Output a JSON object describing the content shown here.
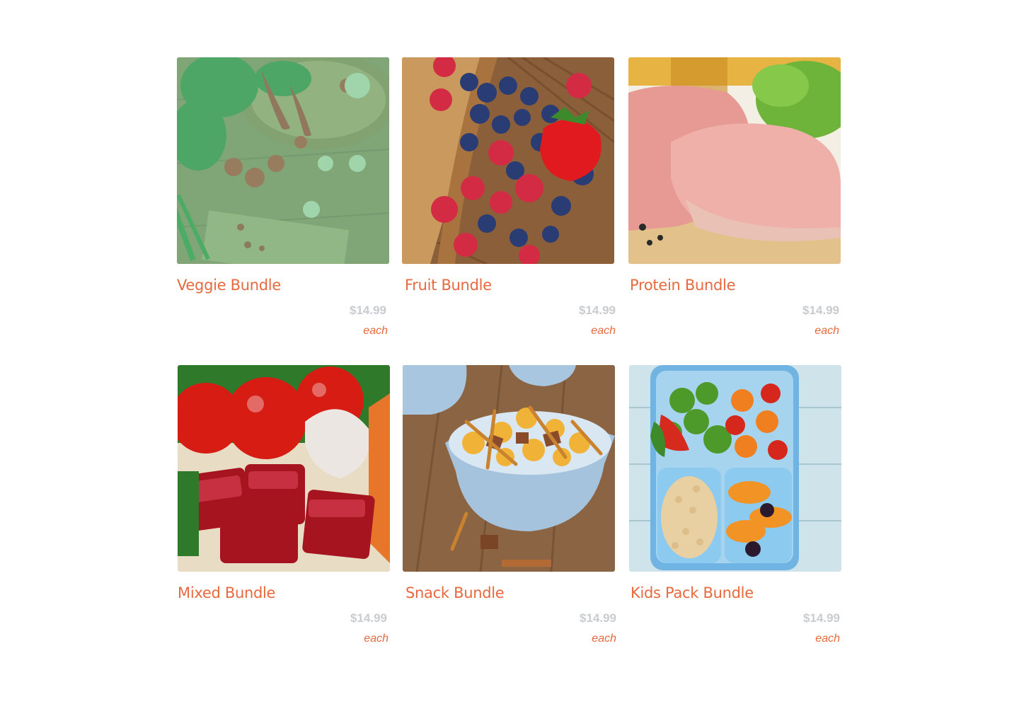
{
  "theme": {
    "accent": "#e8693e",
    "price_color": "#c9cccf"
  },
  "products": [
    {
      "name": "Veggie Bundle",
      "price": "$14.99",
      "unit": "each",
      "image": "veggie-bundle-image",
      "active_overlay": true
    },
    {
      "name": "Fruit Bundle",
      "price": "$14.99",
      "unit": "each",
      "image": "fruit-bundle-image",
      "active_overlay": false
    },
    {
      "name": "Protein Bundle",
      "price": "$14.99",
      "unit": "each",
      "image": "protein-bundle-image",
      "active_overlay": false
    },
    {
      "name": "Mixed Bundle",
      "price": "$14.99",
      "unit": "each",
      "image": "mixed-bundle-image",
      "active_overlay": false
    },
    {
      "name": "Snack Bundle",
      "price": "$14.99",
      "unit": "each",
      "image": "snack-bundle-image",
      "active_overlay": false
    },
    {
      "name": "Kids Pack Bundle",
      "price": "$14.99",
      "unit": "each",
      "image": "kids-pack-bundle-image",
      "active_overlay": false
    }
  ]
}
